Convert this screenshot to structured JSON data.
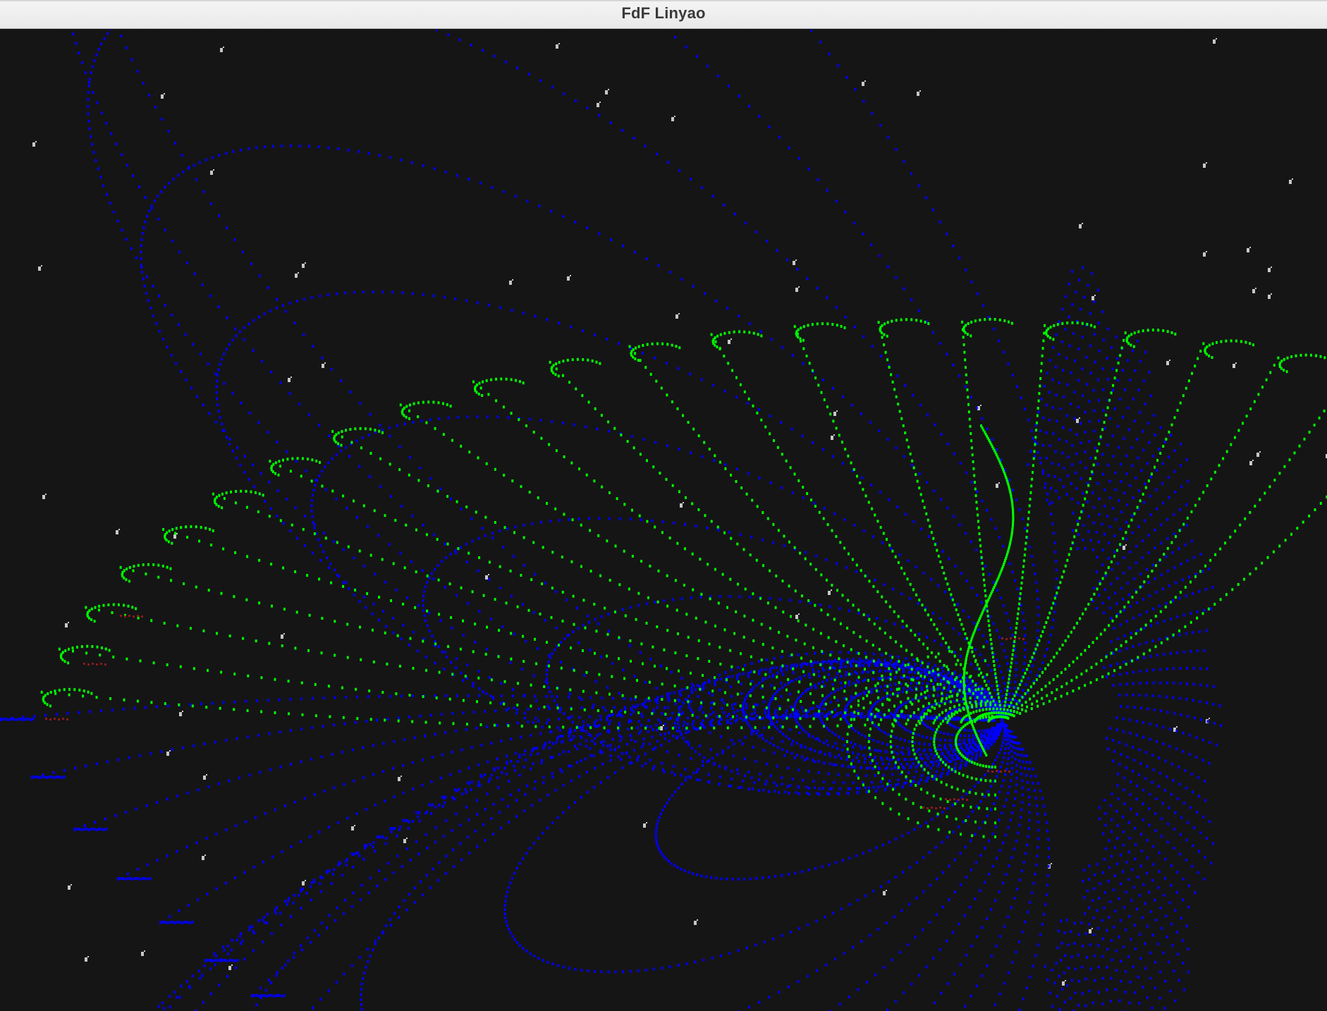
{
  "window": {
    "title": "FdF Linyao"
  },
  "render": {
    "background": "#151515",
    "colors": {
      "low": "#0000ff",
      "high": "#00ff00",
      "mid": "#8b1a1a",
      "stray": "#c8c8c8"
    }
  }
}
